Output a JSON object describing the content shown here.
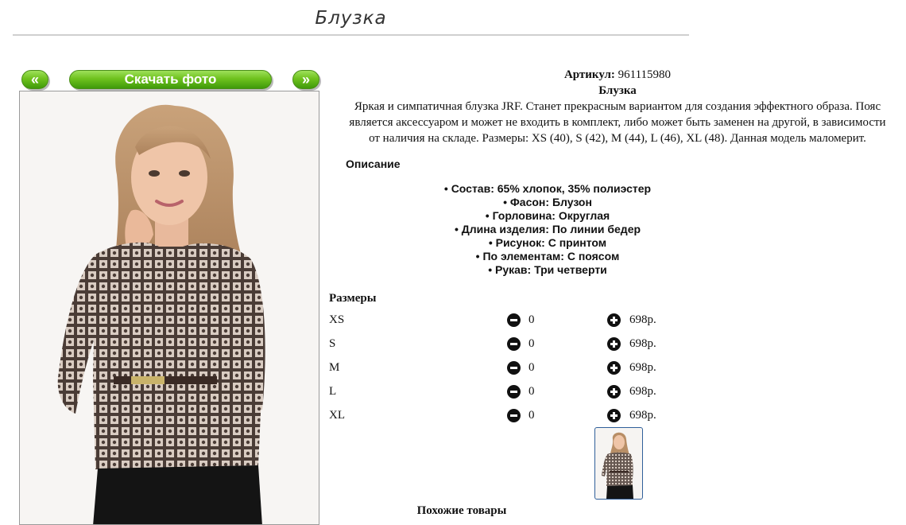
{
  "page": {
    "title": "Блузка"
  },
  "toolbar": {
    "prev_label": "«",
    "download_label": "Скачать фото",
    "next_label": "»"
  },
  "product": {
    "sku_label": "Артикул:",
    "sku": "961115980",
    "name": "Блузка",
    "description_lines": [
      "Яркая и симпатичная блузка JRF. Станет прекрасным вариантом для создания эффектного образа. Пояс",
      "является аксессуаром и может не входить в комплект, либо может быть заменен на другой, в зависимости",
      "от наличия на складе. Размеры: XS (40), S (42), M (44), L (46), XL (48). Данная модель маломерит."
    ]
  },
  "specs": {
    "heading": "Описание",
    "items": [
      "Состав: 65% хлопок, 35% полиэстер",
      "Фасон: Блузон",
      "Горловина: Округлая",
      "Длина изделия: По линии бедер",
      "Рисунок: С принтом",
      "По элементам: С поясом",
      "Рукав: Три четверти"
    ]
  },
  "sizes": {
    "heading": "Размеры",
    "rows": [
      {
        "name": "XS",
        "qty": "0",
        "price": "698р."
      },
      {
        "name": "S",
        "qty": "0",
        "price": "698р."
      },
      {
        "name": "M",
        "qty": "0",
        "price": "698р."
      },
      {
        "name": "L",
        "qty": "0",
        "price": "698р."
      },
      {
        "name": "XL",
        "qty": "0",
        "price": "698р."
      }
    ]
  },
  "similar": {
    "heading": "Похожие товары"
  },
  "colors": {
    "button_green": "#6fc21e",
    "thumb_border": "#2f5f9a",
    "rule": "#cfcfcf"
  },
  "icons": {
    "minus": "minus-circle-icon",
    "plus": "plus-circle-icon"
  }
}
